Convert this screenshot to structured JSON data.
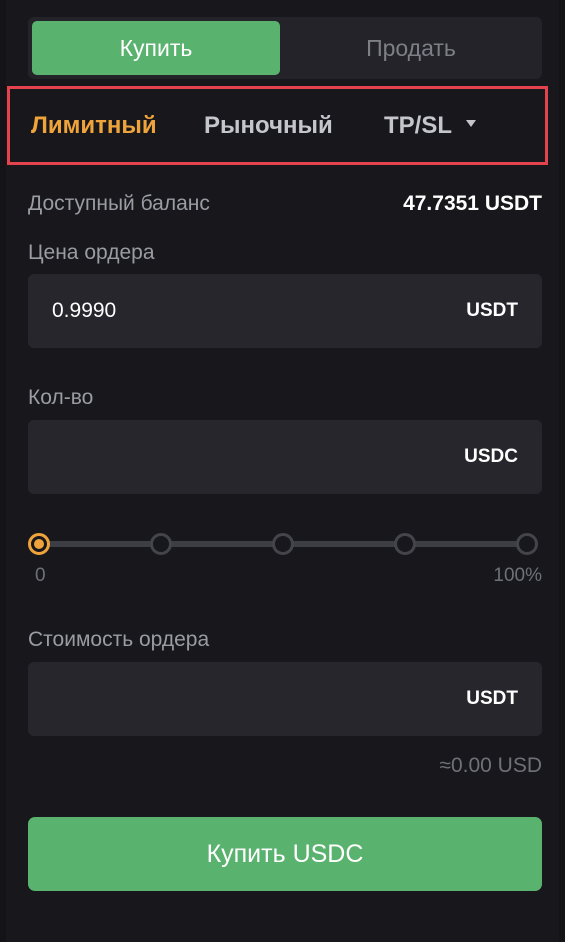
{
  "side_toggle": {
    "buy_label": "Купить",
    "sell_label": "Продать"
  },
  "order_types": {
    "limit": "Лимитный",
    "market": "Рыночный",
    "tpsl": "TP/SL"
  },
  "balance": {
    "label": "Доступный баланс",
    "value": "47.7351 USDT"
  },
  "price": {
    "label": "Цена ордера",
    "value": "0.9990",
    "unit": "USDT"
  },
  "quantity": {
    "label": "Кол-во",
    "value": "",
    "unit": "USDC"
  },
  "slider": {
    "min_label": "0",
    "max_label": "100%",
    "selected_fraction": 0
  },
  "order_value": {
    "label": "Стоимость ордера",
    "value": "",
    "unit": "USDT",
    "approx": "≈0.00 USD"
  },
  "submit_label": "Купить USDC",
  "colors": {
    "buy": "#5ab26f",
    "accent": "#efa43b",
    "highlight_border": "#e3434d"
  }
}
